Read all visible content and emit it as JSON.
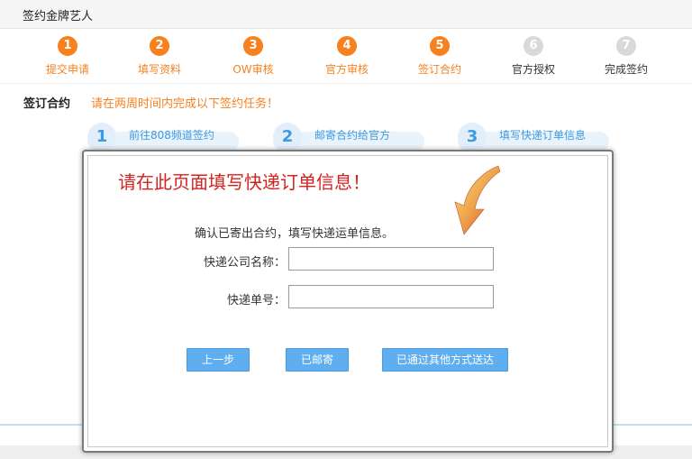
{
  "header": {
    "title": "签约金牌艺人"
  },
  "steps": [
    {
      "num": "1",
      "label": "提交申请"
    },
    {
      "num": "2",
      "label": "填写资料"
    },
    {
      "num": "3",
      "label": "OW审核"
    },
    {
      "num": "4",
      "label": "官方审核"
    },
    {
      "num": "5",
      "label": "签订合约"
    },
    {
      "num": "6",
      "label": "官方授权"
    },
    {
      "num": "7",
      "label": "完成签约"
    }
  ],
  "section": {
    "title": "签订合约",
    "hint": "请在两周时间内完成以下签约任务！"
  },
  "tasks": [
    {
      "num": "1",
      "label": "前往808频道签约"
    },
    {
      "num": "2",
      "label": "邮寄合约给官方"
    },
    {
      "num": "3",
      "label": "填写快递订单信息"
    }
  ],
  "modal": {
    "headline": "请在此页面填写快递订单信息！",
    "confirm_text": "确认已寄出合约，填写快递运单信息。",
    "fields": {
      "company_label": "快递公司名称：",
      "company_value": "",
      "number_label": "快递单号：",
      "number_value": ""
    },
    "buttons": {
      "prev": "上一步",
      "mailed": "已邮寄",
      "other": "已通过其他方式送达"
    }
  },
  "colors": {
    "accent_orange": "#f7811f",
    "link_blue": "#3f9ae0",
    "button_blue": "#5eaef0",
    "headline_red": "#d6221e",
    "inactive_gray": "#d9d9d9"
  }
}
